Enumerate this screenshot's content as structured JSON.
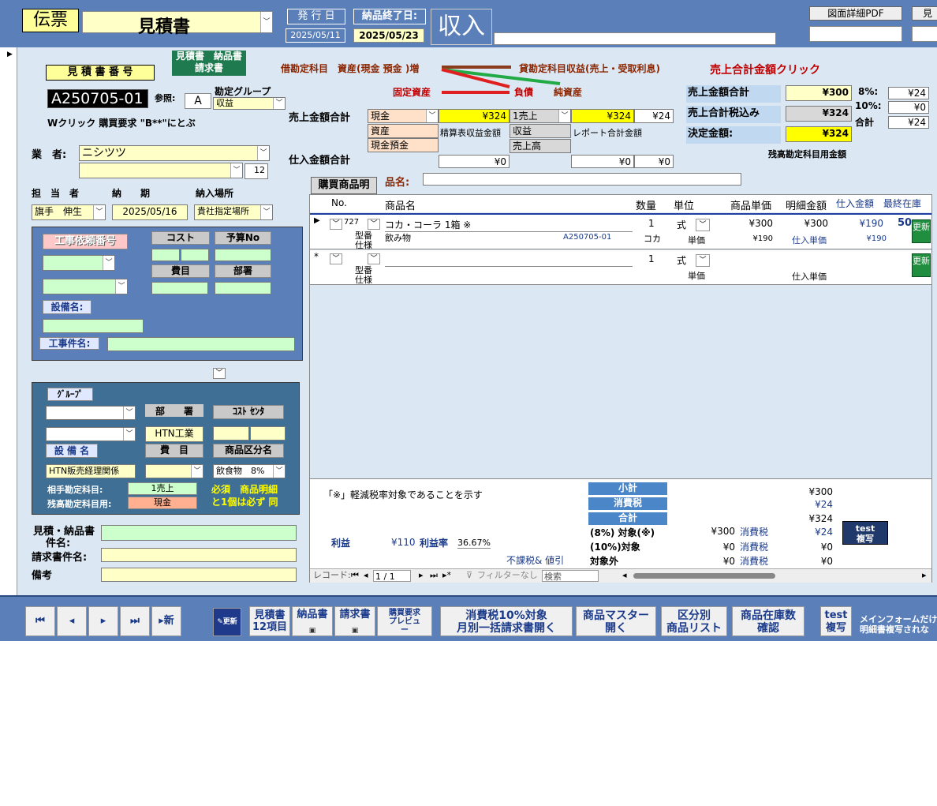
{
  "top": {
    "denpyo": "伝票",
    "doc_type": "見積書",
    "issue_label": "発 行 日",
    "issue_date": "2025/05/11",
    "delivery_end_label": "納品終了日:",
    "delivery_end_date": "2025/05/23",
    "income": "収入",
    "pdf_button": "図面詳細PDF",
    "extra_button": "見"
  },
  "left": {
    "mitsumori_label": "見 積 書 番 号",
    "mitsumori_no": "A250705-01",
    "tab_label_1": "見積書　納品書",
    "tab_label_2": "請求書",
    "ref_label": "参照:",
    "ref_value": "A",
    "kanjo_group_label": "勘定グループ",
    "kanjo_group_value": "収益",
    "wclick_note": "Wクリック 購買要求 \"B**\"にとぶ",
    "gyosha_label": "業　者:",
    "gyosha_value": "ニシツツ",
    "gyosha_code": "12",
    "tanto_label": "担　当　者",
    "noki_label": "納　　期",
    "nonyu_label": "納入場所",
    "tanto_value": "旗手　伸生",
    "noki_value": "2025/05/16",
    "nonyu_value": "貴社指定場所"
  },
  "koji": {
    "irai_label": "工事依頼番号",
    "cost_label": "コスト",
    "yosan_label": "予算No",
    "himoku_label": "費目",
    "busho_label": "部署",
    "setsubi_label": "設備名:",
    "kenmei_label": "工事件名:"
  },
  "group": {
    "group_label": "ｸﾞﾙｰﾌﾟ",
    "busho_label": "部　　署",
    "cost_center_label": "ｺｽﾄ ｾﾝﾀ",
    "busho_value": "HTN工業",
    "setsubi_label": "設 備 名",
    "himoku_label": "費　目",
    "shohin_kubun_label": "商品区分名",
    "setsubi_value": "HTN販売経理関係",
    "shohin_kubun_value": "飲食物　8%",
    "aite_label": "相手勘定科目:",
    "aite_value": "1売上",
    "zandaka_label": "残高勘定科目用:",
    "zandaka_value": "現金",
    "must_note_1": "必須　商品明細",
    "must_note_2": "と1個は必ず 同"
  },
  "bottom_left": {
    "mitsu_kenmei_label_1": "見積・納品書",
    "mitsu_kenmei_label_2": "件名:",
    "seikyu_label": "請求書件名:",
    "biko_label": "備考"
  },
  "journal": {
    "debit_label": "借勘定科目　資産(現金 預金 )増",
    "credit_label": "貸勘定科目収益(売上・受取利息)",
    "kotei_label": "固定資産",
    "fusai_label": "負債",
    "junshisan_label": "純資産",
    "uriage_click": "売上合計金額クリック",
    "uriage_total_label": "売上金額合計",
    "shiire_total_label": "仕入金額合計",
    "genkin": "現金",
    "amt1": "¥324",
    "uriage_item": "1売上",
    "amt2": "¥324",
    "amt3": "¥24",
    "shisan": "資産",
    "seisan_label": "精算表収益金額",
    "shueki": "収益",
    "report_label": "レポート合計金額",
    "genkin_yokin": "現金預金",
    "uriage_daka": "売上高",
    "shiire_1": "¥0",
    "shiire_2": "¥0",
    "shiire_3": "¥0"
  },
  "summary": {
    "total_label": "売上金額合計",
    "total_value": "¥300",
    "tax_incl_label": "売上合計税込み",
    "tax_incl_value": "¥324",
    "kettei_label": "決定金額:",
    "kettei_value": "¥324",
    "rate8_label": "8%:",
    "rate8_value": "¥24",
    "rate10_label": "10%:",
    "rate10_value": "¥0",
    "gokei_label": "合計",
    "gokei_value": "¥24",
    "zandaka_note": "残高勘定科目用金額"
  },
  "detail": {
    "tab": "購買商品明",
    "hinmei_label": "品名:",
    "columns": [
      "No.",
      "商品名",
      "数量",
      "単位",
      "商品単価",
      "明細金額",
      "仕入金額",
      "最終在庫"
    ],
    "row1": {
      "no": "727",
      "name": "コカ・コーラ 1箱 ※",
      "qty": "1",
      "unit": "式",
      "price": "¥300",
      "amount": "¥300",
      "shiire": "¥190",
      "stock": "50",
      "kataban": "型番",
      "shiyo": "仕様",
      "category": "飲み物",
      "code": "A250705-01",
      "unit2": "コカ",
      "tanka_label": "単価",
      "tanka": "¥190",
      "shiire_tanka_label": "仕入単価",
      "shiire_tanka": "¥190",
      "upd": "更新"
    },
    "row2": {
      "qty": "1",
      "unit": "式",
      "kataban": "型番",
      "shiyo": "仕様",
      "tanka_label": "単価",
      "shiire_tanka_label": "仕入単価",
      "upd": "更新"
    },
    "note": "「※」軽減税率対象であることを示す",
    "shokei_label": "小計",
    "shohizei_label": "消費税",
    "gokei_label": "合計",
    "shokei": "¥300",
    "shohizei": "¥24",
    "gokei": "¥324",
    "target8_label": "(8%) 対象(※)",
    "target8": "¥300",
    "tax_label": "消費税",
    "tax8": "¥24",
    "target10_label": "(10%)対象",
    "target10": "¥0",
    "tax10": "¥0",
    "taishogai_label": "対象外",
    "taishogai": "¥0",
    "taxout": "¥0",
    "rieki_label": "利益",
    "rieki": "¥110",
    "riekiritsu_label": "利益率",
    "riekiritsu": "36.67%",
    "fukazei_label": "不課税& 値引",
    "test_label_1": "test",
    "test_label_2": "複写",
    "nav": {
      "record_label": "レコード:",
      "record_value": "1 / 1",
      "filter": "フィルターなし",
      "search": "検索"
    }
  },
  "toolbar": {
    "new": "新",
    "update": "更新",
    "b1a": "見積書",
    "b1b": "12項目",
    "b2": "納品書",
    "b3": "請求書",
    "b4a": "購買要求",
    "b4b": "プレビュ",
    "b4c": "ー",
    "b5a": "消費税10%対象",
    "b5b": "月別一括請求書開く",
    "b6a": "商品マスター",
    "b6b": "開く",
    "b7a": "区分別",
    "b7b": "商品リスト",
    "b8a": "商品在庫数",
    "b8b": "確認",
    "b9a": "test",
    "b9b": "複写",
    "note1": "メインフォームだけ",
    "note2": "明細書複写されな"
  }
}
